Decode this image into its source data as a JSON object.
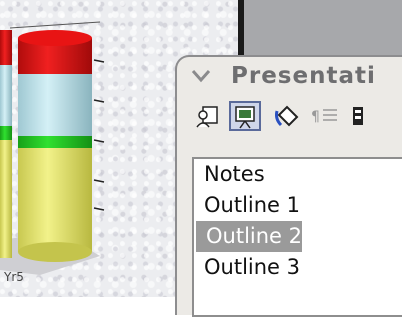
{
  "document": {
    "axis_label": "Yr5"
  },
  "panel": {
    "title": "Presentati",
    "toolbar": [
      {
        "icon": "notes-view-icon"
      },
      {
        "icon": "slide-show-icon",
        "active": true
      },
      {
        "icon": "paint-bucket-icon"
      },
      {
        "icon": "outline-view-icon"
      },
      {
        "icon": "more-icon"
      }
    ],
    "views": [
      {
        "label": "Notes"
      },
      {
        "label": "Outline 1"
      },
      {
        "label": "Outline 2",
        "selected": true
      },
      {
        "label": "Outline 3"
      }
    ]
  },
  "colors": {
    "bar_red": "#e01818",
    "bar_lightblue": "#b8e2ea",
    "bar_green": "#22c522",
    "bar_yellow": "#eaea6a",
    "selection": "#9a9a9a",
    "active_button": "#cfd6ea"
  }
}
